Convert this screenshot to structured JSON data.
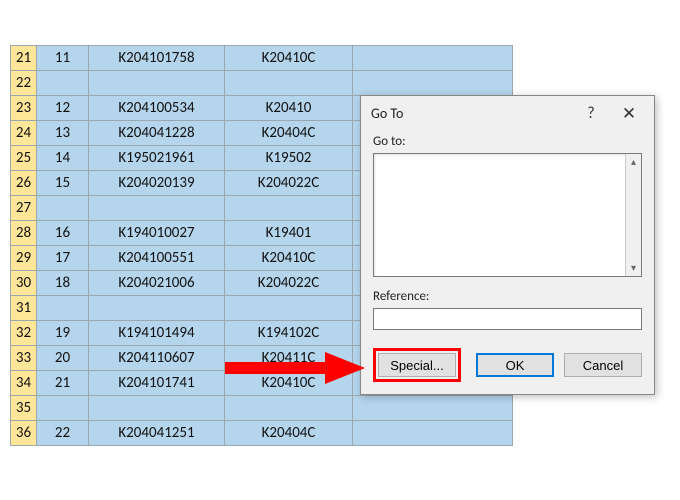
{
  "rows": [
    {
      "header": "21",
      "a": "11",
      "b": "K204101758",
      "c": "K20410C",
      "d": ""
    },
    {
      "header": "22",
      "a": "",
      "b": "",
      "c": "",
      "d": ""
    },
    {
      "header": "23",
      "a": "12",
      "b": "K204100534",
      "c": "K20410",
      "d": ""
    },
    {
      "header": "24",
      "a": "13",
      "b": "K204041228",
      "c": "K20404C",
      "d": ""
    },
    {
      "header": "25",
      "a": "14",
      "b": "K195021961",
      "c": "K19502",
      "d": ""
    },
    {
      "header": "26",
      "a": "15",
      "b": "K204020139",
      "c": "K204022C",
      "d": ""
    },
    {
      "header": "27",
      "a": "",
      "b": "",
      "c": "",
      "d": ""
    },
    {
      "header": "28",
      "a": "16",
      "b": "K194010027",
      "c": "K19401",
      "d": ""
    },
    {
      "header": "29",
      "a": "17",
      "b": "K204100551",
      "c": "K20410C",
      "d": ""
    },
    {
      "header": "30",
      "a": "18",
      "b": "K204021006",
      "c": "K204022C",
      "d": ""
    },
    {
      "header": "31",
      "a": "",
      "b": "",
      "c": "",
      "d": ""
    },
    {
      "header": "32",
      "a": "19",
      "b": "K194101494",
      "c": "K194102C",
      "d": ""
    },
    {
      "header": "33",
      "a": "20",
      "b": "K204110607",
      "c": "K20411C",
      "d": ""
    },
    {
      "header": "34",
      "a": "21",
      "b": "K204101741",
      "c": "K20410C",
      "d": ""
    },
    {
      "header": "35",
      "a": "",
      "b": "",
      "c": "",
      "d": ""
    },
    {
      "header": "36",
      "a": "22",
      "b": "K204041251",
      "c": "K20404C",
      "d": ""
    }
  ],
  "dialog": {
    "title": "Go To",
    "help": "?",
    "close": "✕",
    "goto_label": "Go to:",
    "reference_label": "Reference:",
    "reference_value": "",
    "special_label": "Special...",
    "ok_label": "OK",
    "cancel_label": "Cancel"
  }
}
